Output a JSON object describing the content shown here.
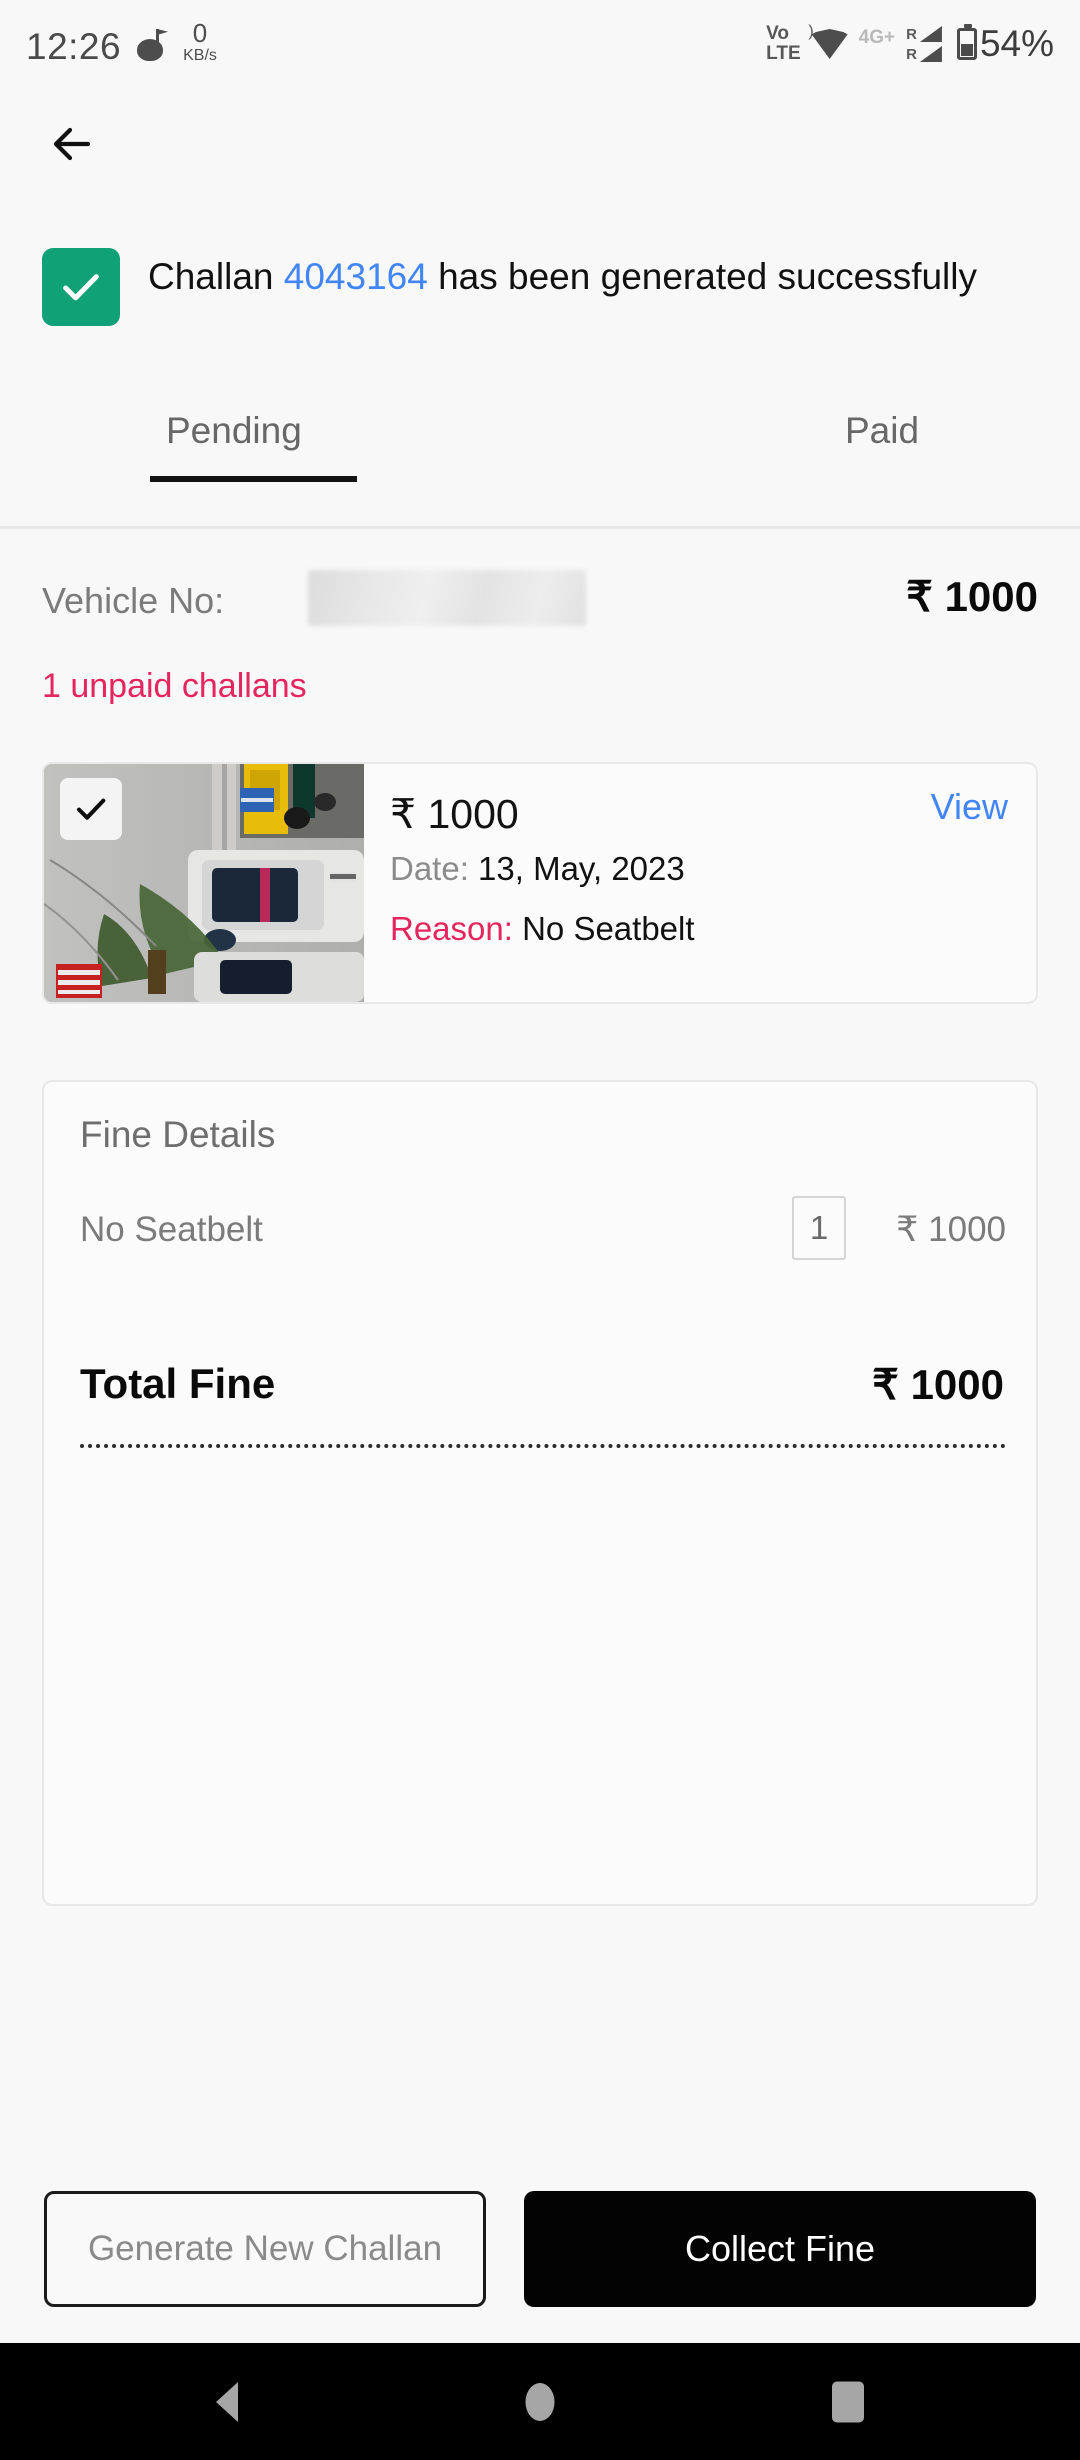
{
  "status_bar": {
    "time": "12:26",
    "data_speed_value": "0",
    "data_speed_unit": "KB/s",
    "volte_top": "Vo",
    "volte_bottom": "LTE",
    "network": "4G+",
    "sim1_label": "R",
    "sim2_label": "R",
    "battery": "54%"
  },
  "nav": {
    "back_icon": "arrow-left-icon"
  },
  "banner": {
    "prefix": "Challan ",
    "challan_number": "4043164",
    "suffix": " has been generated successfully",
    "icon": "check-icon",
    "accent_color": "#11a176",
    "link_color": "#4285f4"
  },
  "tabs": {
    "items": [
      {
        "label": "Pending",
        "active": true
      },
      {
        "label": "Paid",
        "active": false
      }
    ]
  },
  "vehicle": {
    "label": "Vehicle No:",
    "number": "",
    "amount": "₹ 1000",
    "unpaid_text": "1 unpaid challans",
    "unpaid_color": "#e5255e"
  },
  "challan_card": {
    "checkbox_icon": "check-icon",
    "checked": true,
    "amount": "₹ 1000",
    "date_label": "Date:",
    "date_value": " 13, May, 2023",
    "reason_label": "Reason:",
    "reason_value": " No Seatbelt",
    "view_label": "View",
    "view_color": "#4285f4"
  },
  "fine_details": {
    "title": "Fine Details",
    "rows": [
      {
        "name": "No Seatbelt",
        "qty": "1",
        "price": "₹ 1000"
      }
    ],
    "total_label": "Total Fine",
    "total_value": "₹ 1000"
  },
  "actions": {
    "secondary_label": "Generate New Challan",
    "primary_label": "Collect Fine",
    "primary_bg": "#030303"
  },
  "system_nav": {
    "back": "triangle-back-icon",
    "home": "circle-home-icon",
    "recents": "square-recents-icon"
  }
}
